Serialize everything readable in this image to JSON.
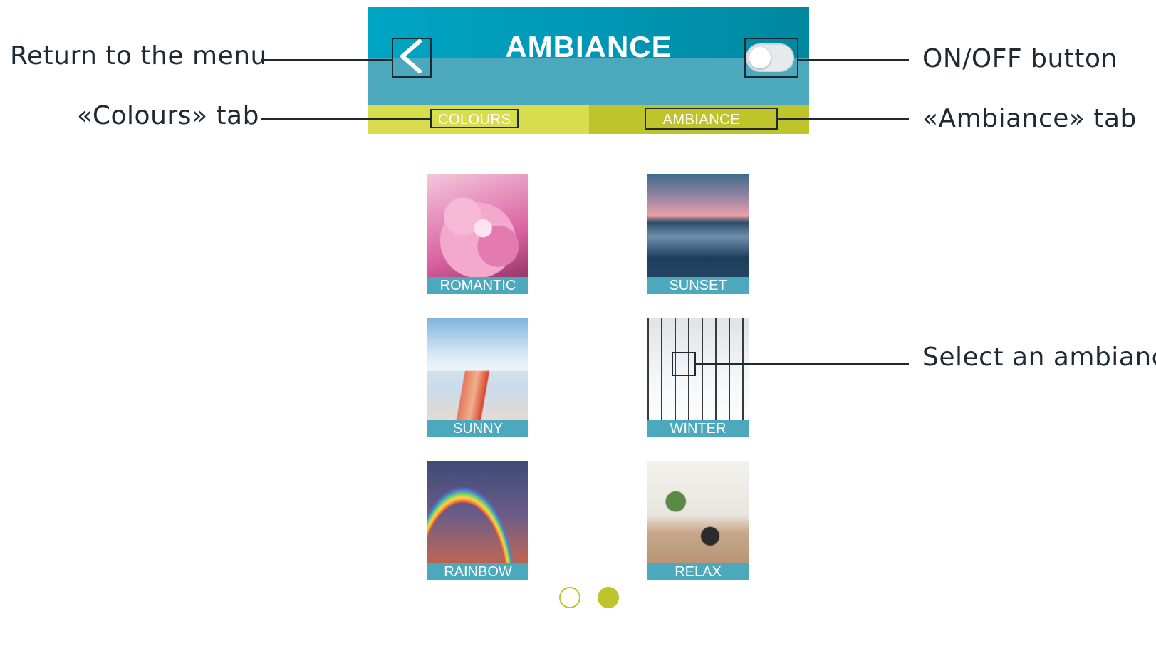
{
  "app": {
    "title": "AMBIANCE",
    "toggle_state": "off",
    "colors": {
      "header": "#00a5c4",
      "header_lower": "#4ca9bd",
      "tab_inactive": "#d7dd4c",
      "tab_active": "#bfc42a",
      "tile_label_bg": "#4ca9bd"
    }
  },
  "tabs": [
    {
      "label": "COLOURS",
      "active": false
    },
    {
      "label": "AMBIANCE",
      "active": true
    }
  ],
  "ambiances": [
    {
      "label": "ROMANTIC",
      "image": "pink-peony-photo"
    },
    {
      "label": "SUNSET",
      "image": "beach-sunset-photo"
    },
    {
      "label": "SUNNY",
      "image": "pier-sunny-photo"
    },
    {
      "label": "WINTER",
      "image": "snowy-forest-photo"
    },
    {
      "label": "RAINBOW",
      "image": "rainbow-photo"
    },
    {
      "label": "RELAX",
      "image": "spa-stones-photo"
    }
  ],
  "pagination": {
    "pages": 2,
    "current": 2
  },
  "annotations": {
    "return_menu": "Return to the menu",
    "colours_tab": "«Colours» tab",
    "onoff_button": "ON/OFF button",
    "ambiance_tab": "«Ambiance» tab",
    "select_ambiance": "Select an ambiance"
  },
  "icons": {
    "back": "chevron-left-icon",
    "toggle": "toggle-switch-icon"
  }
}
